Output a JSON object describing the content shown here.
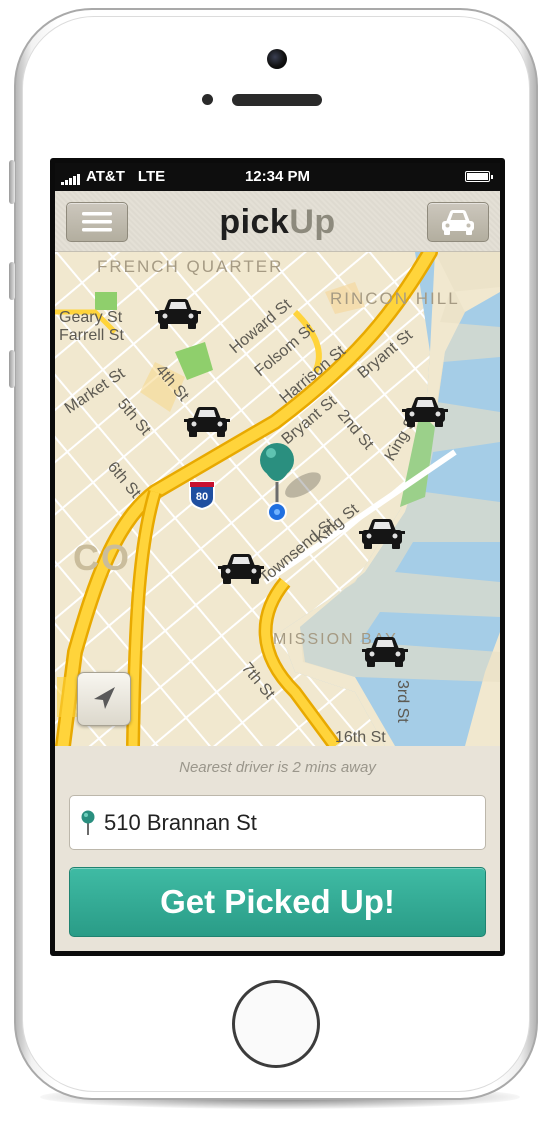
{
  "statusbar": {
    "carrier": "AT&T",
    "network": "LTE",
    "time": "12:34 PM"
  },
  "app": {
    "title_part1": "pick",
    "title_part2": "Up",
    "menu_icon": "hamburger-menu-icon",
    "car_icon": "car-icon"
  },
  "map": {
    "areas": [
      "FRENCH QUARTER",
      "RINCON HILL",
      "MISSION BAY",
      "CO"
    ],
    "streets": [
      "Geary St",
      "Farrell St",
      "Market St",
      "4th St",
      "5th St",
      "6th St",
      "Howard St",
      "Folsom St",
      "Harrison St",
      "Bryant St",
      "2nd St",
      "King St",
      "Townsend St",
      "Bryant St",
      "7th St",
      "3rd St",
      "16th St"
    ],
    "highway_shield": "80",
    "locate_icon": "location-arrow-icon"
  },
  "panel": {
    "nearest_text": "Nearest driver is 2 mins away",
    "address": "510 Brannan St",
    "cta_label": "Get Picked Up!"
  },
  "colors": {
    "accent": "#35ad97",
    "pin": "#2a8f7f",
    "water": "#a5cde7"
  }
}
